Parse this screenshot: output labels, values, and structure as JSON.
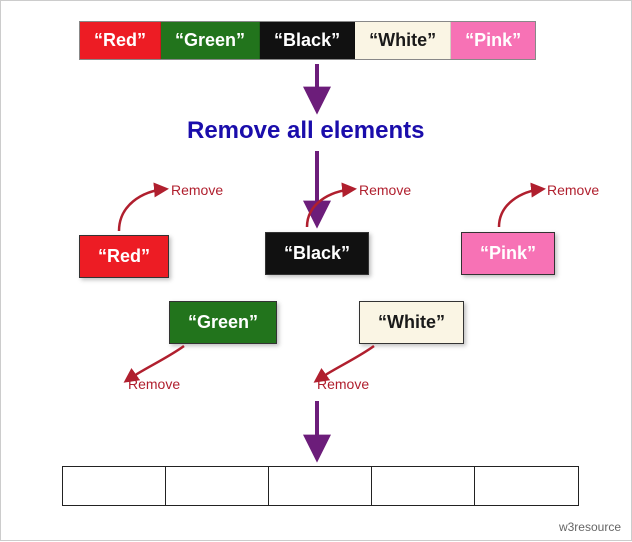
{
  "title": "Remove all elements",
  "colors_row": [
    "“Red”",
    "“Green”",
    "“Black”",
    "“White”",
    "“Pink”"
  ],
  "scattered": {
    "red": "“Red”",
    "green": "“Green”",
    "black": "“Black”",
    "white": "“White”",
    "pink": "“Pink”"
  },
  "remove_label": "Remove",
  "empty_count": 5,
  "attribution": "w3resource",
  "palette": {
    "red": "#ed1c24",
    "green": "#22741c",
    "black": "#111111",
    "white": "#faf5e4",
    "pink": "#f772b5",
    "title": "#1a0dab",
    "arrow": "#6c1d7a",
    "remove_arrow": "#b01f2e"
  }
}
